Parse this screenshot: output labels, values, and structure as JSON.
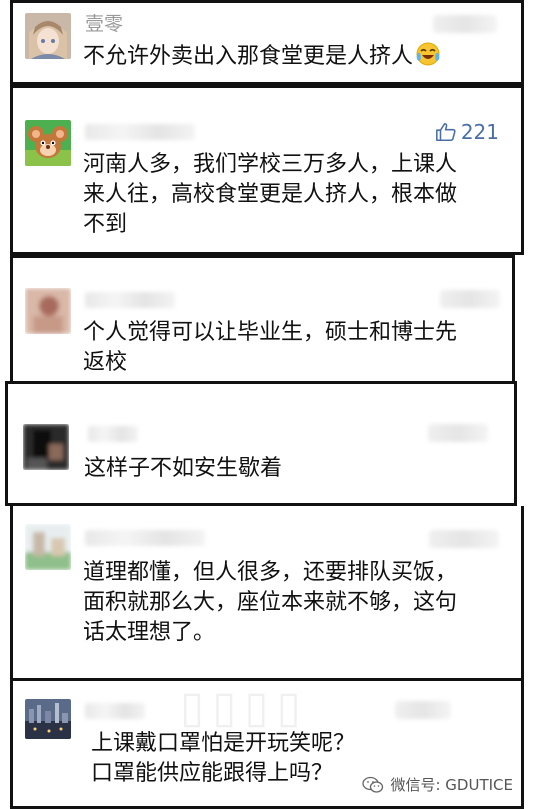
{
  "comments": [
    {
      "name": "壹零",
      "text_lines": [
        "不允许外卖出入那食堂更是人挤人"
      ],
      "emoji": "crying-laughing-emoji"
    },
    {
      "likes": "221",
      "text_lines": [
        "河南人多，我们学校三万多人，上课人",
        "来人往，高校食堂更是人挤人，根本做",
        "不到"
      ]
    },
    {
      "text_lines": [
        "个人觉得可以让毕业生，硕士和博士先",
        "返校"
      ]
    },
    {
      "text_lines": [
        "这样子不如安生歇着"
      ]
    },
    {
      "text_lines": [
        "道理都懂，但人很多，还要排队买饭，",
        "面积就那么大，座位本来就不够，这句",
        "话太理想了。"
      ]
    },
    {
      "text_lines": [
        "上课戴口罩怕是开玩笑呢？",
        "口罩能供应能跟得上吗？"
      ]
    }
  ],
  "watermark": {
    "text": "微信号: GDUTICE",
    "icon": "wechat-icon"
  },
  "colors": {
    "border": "#111111",
    "like": "#4a6fa5",
    "name": "#999999"
  }
}
